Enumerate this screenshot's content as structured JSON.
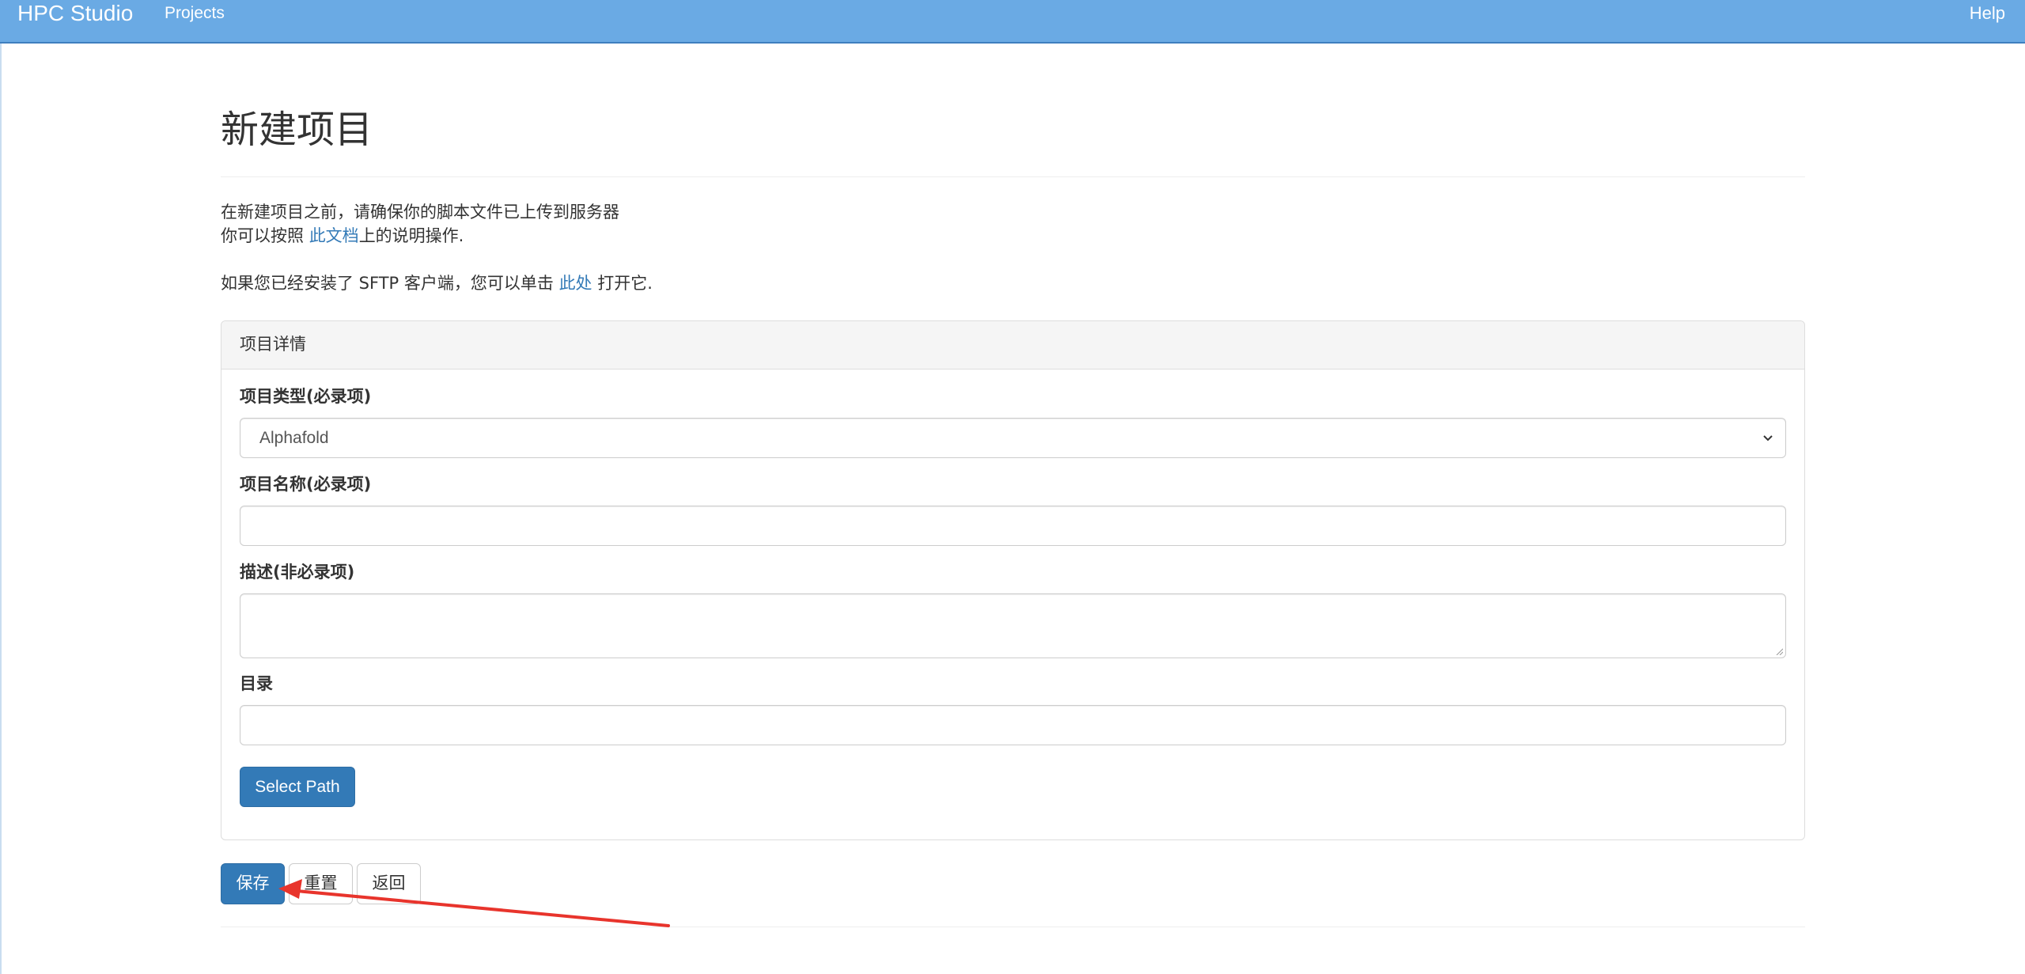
{
  "navbar": {
    "brand": "HPC Studio",
    "projects": "Projects",
    "help": "Help"
  },
  "page": {
    "title": "新建项目",
    "intro_line1": "在新建项目之前，请确保你的脚本文件已上传到服务器",
    "intro_line2_prefix": "你可以按照 ",
    "intro_line2_link": "此文档",
    "intro_line2_suffix": "上的说明操作.",
    "sftp_prefix": "如果您已经安装了 SFTP 客户端，您可以单击 ",
    "sftp_link": "此处",
    "sftp_suffix": " 打开它."
  },
  "panel": {
    "heading": "项目详情",
    "type_label": "项目类型(必录项)",
    "type_value": "Alphafold",
    "name_label": "项目名称(必录项)",
    "name_value": "",
    "desc_label": "描述(非必录项)",
    "desc_value": "",
    "dir_label": "目录",
    "dir_value": "",
    "select_path": "Select Path"
  },
  "actions": {
    "save": "保存",
    "reset": "重置",
    "back": "返回"
  },
  "colors": {
    "navbar": "#6aaae4",
    "primary": "#337ab7",
    "annotation_arrow": "#e8342c"
  },
  "icons": {
    "select_chevron": "chevron-down-icon",
    "annotation": "red-arrow-annotation"
  }
}
